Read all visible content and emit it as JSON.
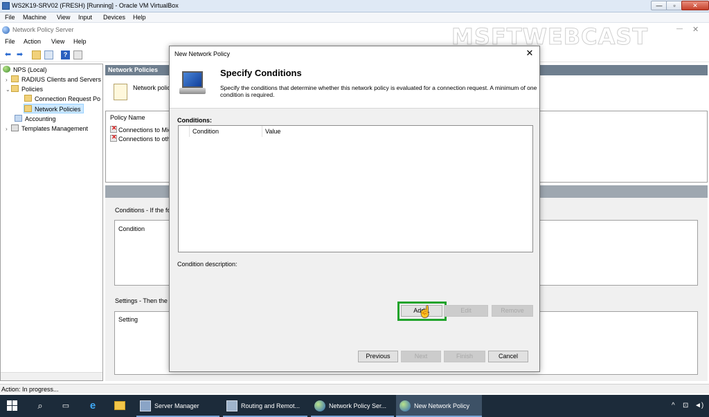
{
  "vbox": {
    "title": "WS2K19-SRV02 (FRESH) [Running] - Oracle VM VirtualBox",
    "menu": [
      "File",
      "Machine",
      "View",
      "Input",
      "Devices",
      "Help"
    ],
    "min_glyph": "—",
    "max_glyph": "▫",
    "close_glyph": "✕"
  },
  "nps": {
    "title": "Network Policy Server",
    "menu": [
      "File",
      "Action",
      "View",
      "Help"
    ],
    "min_glyph": "—",
    "close_glyph": "✕",
    "tree": {
      "root": "NPS (Local)",
      "radius": "RADIUS Clients and Servers",
      "policies": "Policies",
      "conn_request": "Connection Request Po",
      "network_policies": "Network Policies",
      "accounting": "Accounting",
      "templates": "Templates Management"
    },
    "right_header": "Network Policies",
    "intro_text": "Network polici",
    "policy_name_header": "Policy Name",
    "policy_rows": [
      "Connections to Micr",
      "Connections to othe"
    ],
    "conditions_label": "Conditions - If the folli",
    "condition_col": "Condition",
    "settings_label": "Settings - Then the fo",
    "setting_col": "Setting",
    "status": "Action:  In progress..."
  },
  "watermark": "MSFTWEBCAST",
  "dialog": {
    "title": "New Network Policy",
    "close": "✕",
    "heading": "Specify Conditions",
    "description": "Specify the conditions that determine whether this network policy is evaluated for a connection request. A minimum of one condition is required.",
    "conditions_label": "Conditions:",
    "col_condition": "Condition",
    "col_value": "Value",
    "condition_description_label": "Condition description:",
    "add": "Add...",
    "edit": "Edit",
    "remove": "Remove",
    "previous": "Previous",
    "next": "Next",
    "finish": "Finish",
    "cancel": "Cancel"
  },
  "taskbar": {
    "apps": [
      "Server Manager",
      "Routing and Remot...",
      "Network Policy Ser...",
      "New Network Policy"
    ],
    "tray": {
      "chevron": "^",
      "network": "⊡",
      "volume": "◄)"
    }
  }
}
